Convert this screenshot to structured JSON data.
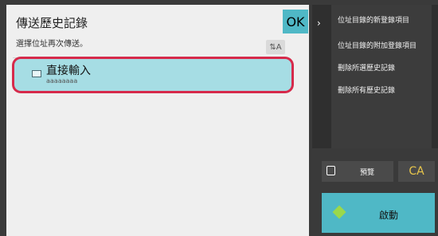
{
  "header": {
    "title": "傳送歷史記錄",
    "subtitle": "選擇位址再次傳送。",
    "ok_label": "OK"
  },
  "list": {
    "items": [
      {
        "name": "直接輸入",
        "address": "aaaaaaaa",
        "icon": "mail-icon"
      }
    ]
  },
  "side_menu": {
    "items": [
      "位址目錄的新登錄項目",
      "位址目錄的附加登錄項目",
      "刪除所選歷史記錄",
      "刪除所有歷史記錄"
    ]
  },
  "actions": {
    "preview_label": "預覽",
    "ca_label": "CA",
    "start_label": "啟動"
  },
  "colors": {
    "accent": "#4fb8c6",
    "selection_outline": "#d62a4b",
    "ca_text": "#e8c64b"
  }
}
